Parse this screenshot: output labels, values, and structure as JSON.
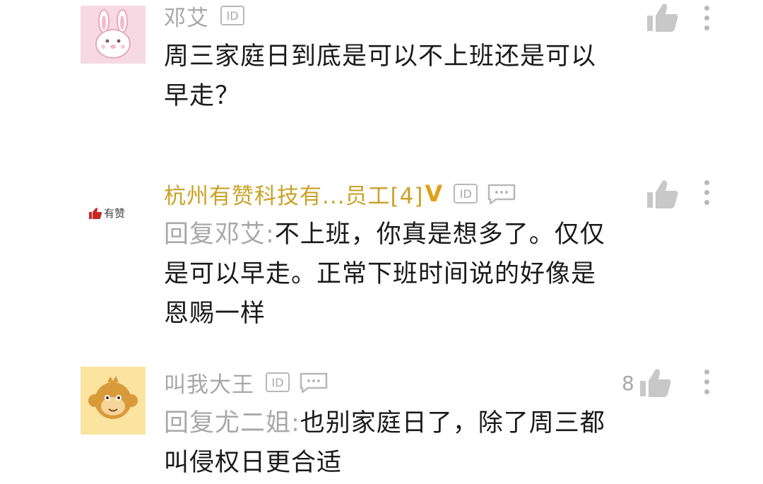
{
  "comments": [
    {
      "username": "邓艾",
      "id_badge": "ID",
      "body_lines": [
        "周三家庭日到底是可以不上班还是可以",
        "早走？"
      ],
      "avatar_icon": "bunny-avatar-icon",
      "avatar_bg": "#f7d9e4"
    },
    {
      "username": "杭州有赞科技有...员工[4]",
      "verified": "V",
      "id_badge": "ID",
      "brand_logo_text": "有赞",
      "reply_prefix": "回复邓艾:",
      "body_lines_first": "不上班，你真是想多了。仅仅",
      "body_lines": [
        "是可以早走。正常下班时间说的好像是",
        "恩赐一样"
      ],
      "accent": "#c9a227"
    },
    {
      "username": "叫我大王",
      "id_badge": "ID",
      "reply_prefix": "回复尤二姐:",
      "body_lines_first": "也别家庭日了，除了周三都",
      "body_lines": [
        "叫侵权日更合适"
      ],
      "like_count": "8",
      "avatar_icon": "monkey-avatar-icon",
      "avatar_bg": "#fbe3a0"
    }
  ]
}
